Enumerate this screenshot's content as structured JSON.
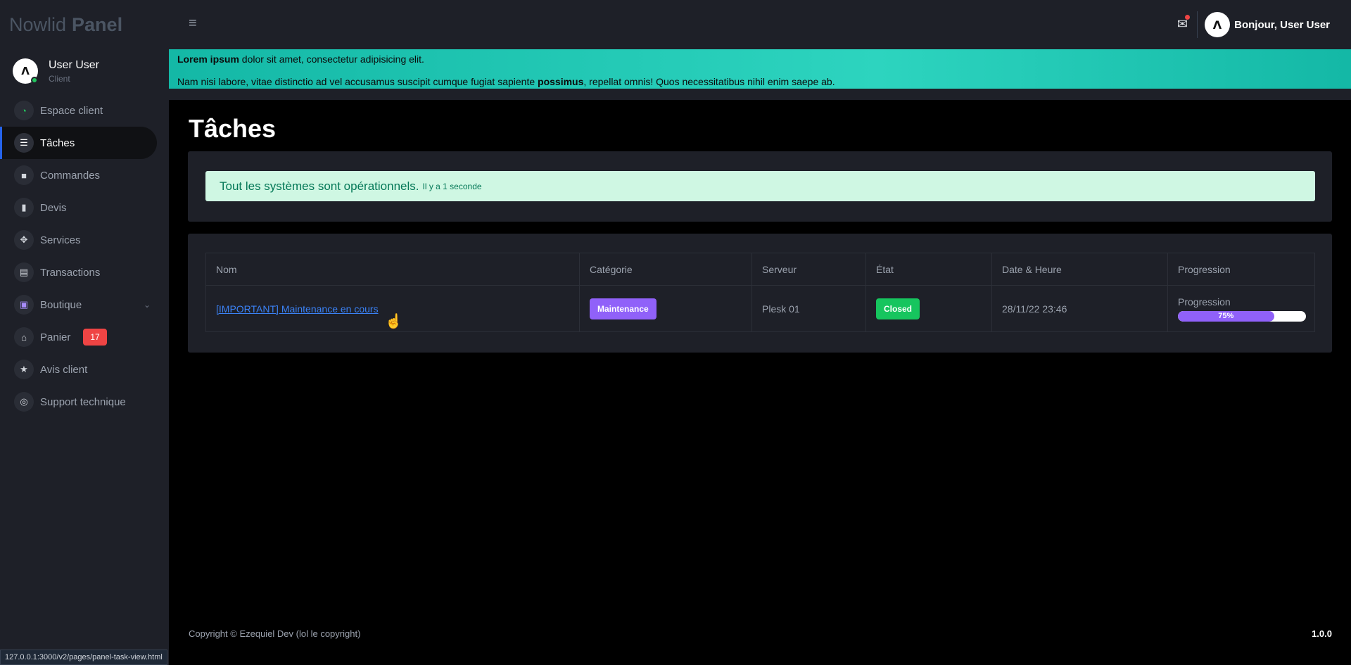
{
  "brand": {
    "light": "Nowlid",
    "bold": "Panel"
  },
  "user": {
    "name": "User User",
    "role": "Client"
  },
  "sidebar": {
    "items": [
      {
        "label": "Espace client",
        "icon": "dashboard-icon",
        "glyph": "◔"
      },
      {
        "label": "Tâches",
        "icon": "tasks-icon",
        "glyph": "☰"
      },
      {
        "label": "Commandes",
        "icon": "box-icon",
        "glyph": "■"
      },
      {
        "label": "Devis",
        "icon": "document-icon",
        "glyph": "▮"
      },
      {
        "label": "Services",
        "icon": "cubes-icon",
        "glyph": "✥"
      },
      {
        "label": "Transactions",
        "icon": "receipt-icon",
        "glyph": "▤"
      },
      {
        "label": "Boutique",
        "icon": "store-icon",
        "glyph": "▣"
      },
      {
        "label": "Panier",
        "icon": "basket-icon",
        "glyph": "⌂",
        "badge": "17"
      },
      {
        "label": "Avis client",
        "icon": "star-icon",
        "glyph": "★"
      },
      {
        "label": "Support technique",
        "icon": "lifebuoy-icon",
        "glyph": "◎"
      }
    ]
  },
  "header": {
    "greeting": "Bonjour, User User"
  },
  "notice": {
    "line1_bold": "Lorem ipsum",
    "line1_rest": " dolor sit amet, consectetur adipisicing elit.",
    "line2_start": "Nam nisi labore, vitae distinctio ad vel accusamus suscipit cumque fugiat sapiente ",
    "line2_bold": "possimus",
    "line2_end": ", repellat omnis! Quos necessitatibus nihil enim saepe ab."
  },
  "page": {
    "title": "Tâches"
  },
  "status": {
    "message": "Tout les systèmes sont opérationnels.",
    "time": "Il y a 1 seconde"
  },
  "table": {
    "headers": [
      "Nom",
      "Catégorie",
      "Serveur",
      "État",
      "Date & Heure",
      "Progression"
    ],
    "row": {
      "name": "[IMPORTANT] Maintenance en cours",
      "category": "Maintenance",
      "server": "Plesk 01",
      "state": "Closed",
      "datetime": "28/11/22 23:46",
      "progress_label": "Progression",
      "progress_text": "75%",
      "progress_value": 75
    }
  },
  "footer": {
    "copyright": "Copyright © Ezequiel Dev (lol le copyright)",
    "version": "1.0.0"
  },
  "status_url": "127.0.0.1:3000/v2/pages/panel-task-view.html",
  "colors": {
    "accent": "#9061f9",
    "success": "#16c55e",
    "danger": "#ef4444",
    "notice": "#14b8a6"
  }
}
